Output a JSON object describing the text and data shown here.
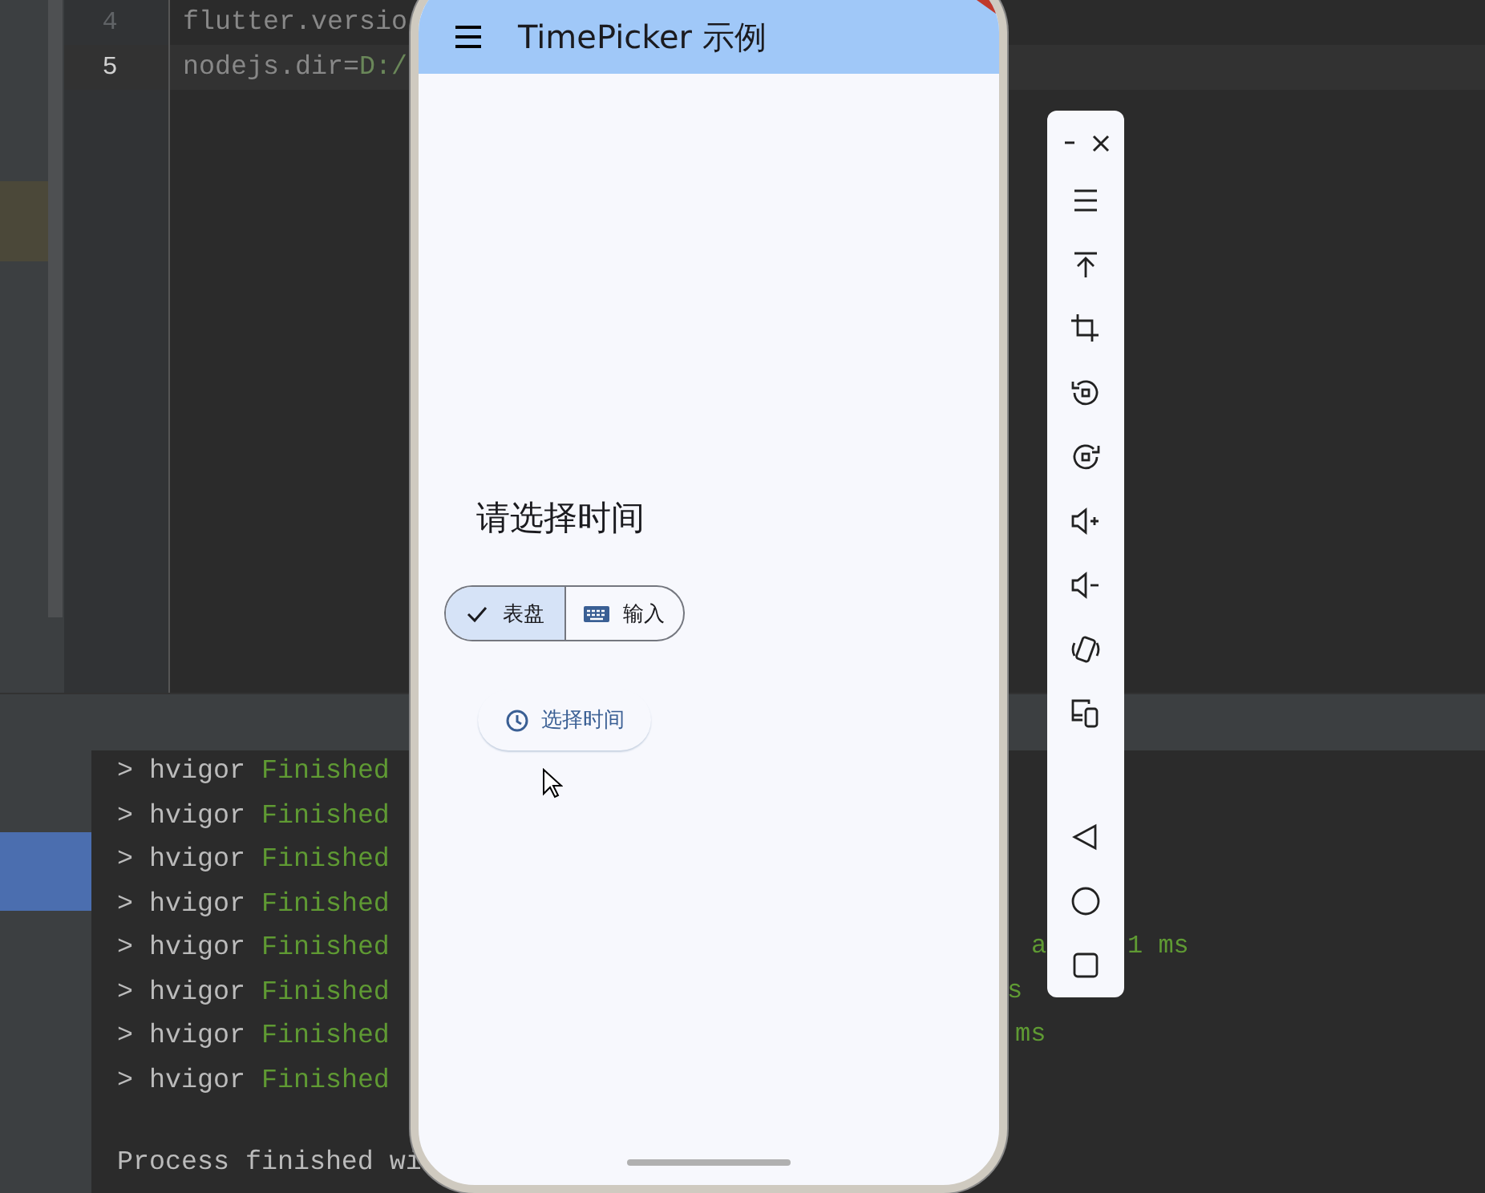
{
  "editor": {
    "lines": [
      {
        "number": "4",
        "key": "flutter.versio",
        "current": false
      },
      {
        "number": "5",
        "key": "nodejs.dir=",
        "value": "D:/",
        "current": true
      }
    ]
  },
  "console": {
    "lines": [
      {
        "prompt": "> hvigor",
        "status": "Finished"
      },
      {
        "prompt": "> hvigor",
        "status": "Finished"
      },
      {
        "prompt": "> hvigor",
        "status": "Finished"
      },
      {
        "prompt": "> hvigor",
        "status": "Finished"
      },
      {
        "prompt": "> hvigor",
        "status": "Finished",
        "tails": [
          "a",
          "1 ms"
        ]
      },
      {
        "prompt": "> hvigor",
        "status": "Finished",
        "tails": [
          "s"
        ]
      },
      {
        "prompt": "> hvigor",
        "status": "Finished",
        "tails": [
          "ms"
        ]
      },
      {
        "prompt": "> hvigor",
        "status": "Finished"
      }
    ],
    "footer": "Process finished wi"
  },
  "app": {
    "title": "TimePicker 示例",
    "heading": "请选择时间",
    "modes": [
      {
        "label": "表盘",
        "kind": "dial",
        "selected": true
      },
      {
        "label": "输入",
        "kind": "input",
        "selected": false
      }
    ],
    "action": "选择时间"
  },
  "toolbar": {
    "tools": [
      {
        "kind": "menu"
      },
      {
        "kind": "top"
      },
      {
        "kind": "crop"
      },
      {
        "kind": "rotate-left"
      },
      {
        "kind": "rotate-right"
      },
      {
        "kind": "volume-up"
      },
      {
        "kind": "volume-down"
      },
      {
        "kind": "shake"
      },
      {
        "kind": "devices"
      }
    ],
    "nav": [
      {
        "kind": "back"
      },
      {
        "kind": "home"
      },
      {
        "kind": "recent"
      }
    ]
  }
}
